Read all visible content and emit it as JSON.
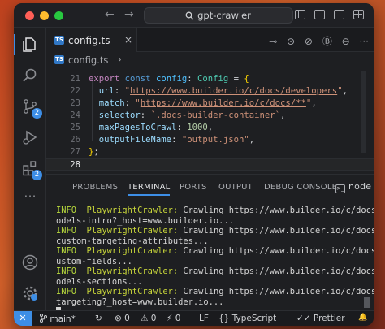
{
  "window": {
    "title": "gpt-crawler",
    "nav_back": "←",
    "nav_forward": "→"
  },
  "tab": {
    "label": "config.ts",
    "icon": "TS",
    "close": "×"
  },
  "editor_actions": [
    "⊸",
    "⊙",
    "⊘",
    "Ⓑ",
    "⊖",
    "···"
  ],
  "breadcrumb": {
    "file": "config.ts",
    "sep": "›"
  },
  "code": {
    "lines": [
      {
        "n": "21",
        "segments": [
          [
            "kw",
            "export "
          ],
          [
            "kw2",
            "const "
          ],
          [
            "var",
            "config"
          ],
          [
            "punc",
            ": "
          ],
          [
            "typ",
            "Config"
          ],
          [
            "punc",
            " = "
          ],
          [
            "brace",
            "{"
          ]
        ]
      },
      {
        "n": "22",
        "segments": [
          [
            "punc",
            "  "
          ],
          [
            "prop",
            "url"
          ],
          [
            "punc",
            ": "
          ],
          [
            "str",
            "\""
          ],
          [
            "str lnk",
            "https://www.builder.io/c/docs/developers"
          ],
          [
            "str",
            "\""
          ],
          [
            "punc",
            ","
          ]
        ]
      },
      {
        "n": "23",
        "segments": [
          [
            "punc",
            "  "
          ],
          [
            "prop",
            "match"
          ],
          [
            "punc",
            ": "
          ],
          [
            "str",
            "\""
          ],
          [
            "str lnk",
            "https://www.builder.io/c/docs/**"
          ],
          [
            "str",
            "\""
          ],
          [
            "punc",
            ","
          ]
        ]
      },
      {
        "n": "24",
        "segments": [
          [
            "punc",
            "  "
          ],
          [
            "prop",
            "selector"
          ],
          [
            "punc",
            ": "
          ],
          [
            "str",
            "`.docs-builder-container`"
          ],
          [
            "punc",
            ","
          ]
        ]
      },
      {
        "n": "25",
        "segments": [
          [
            "punc",
            "  "
          ],
          [
            "prop",
            "maxPagesToCrawl"
          ],
          [
            "punc",
            ": "
          ],
          [
            "num",
            "1000"
          ],
          [
            "punc",
            ","
          ]
        ]
      },
      {
        "n": "26",
        "segments": [
          [
            "punc",
            "  "
          ],
          [
            "prop",
            "outputFileName"
          ],
          [
            "punc",
            ": "
          ],
          [
            "str",
            "\"output.json\""
          ],
          [
            "punc",
            ","
          ]
        ]
      },
      {
        "n": "27",
        "segments": [
          [
            "brace",
            "}"
          ],
          [
            "punc",
            ";"
          ]
        ]
      },
      {
        "n": "28",
        "segments": []
      }
    ]
  },
  "panel": {
    "tabs": [
      "PROBLEMS",
      "TERMINAL",
      "PORTS",
      "OUTPUT",
      "DEBUG CONSOLE"
    ],
    "active_tab": "TERMINAL",
    "terminal_name": "node",
    "terminal_icon": ">_",
    "terminal_lines": [
      "odels-intro?_host=www.builder.io...",
      "custom-targeting-attributes...",
      "ustom-fields...",
      "odels-sections...",
      "targeting?_host=www.builder.io..."
    ],
    "terminal_info_lines": [
      {
        "level": "INFO",
        "source": "PlaywrightCrawler:",
        "msg": " Crawling https://www.builder.io/c/docs/m"
      },
      {
        "level": "INFO",
        "source": "PlaywrightCrawler:",
        "msg": " Crawling https://www.builder.io/c/docs/"
      },
      {
        "level": "INFO",
        "source": "PlaywrightCrawler:",
        "msg": " Crawling https://www.builder.io/c/docs/c"
      },
      {
        "level": "INFO",
        "source": "PlaywrightCrawler:",
        "msg": " Crawling https://www.builder.io/c/docs/m"
      },
      {
        "level": "INFO",
        "source": "PlaywrightCrawler:",
        "msg": " Crawling https://www.builder.io/c/docs/t"
      }
    ]
  },
  "status": {
    "remote": "✕",
    "branch": "main*",
    "sync": "↻",
    "errors": "⊗ 0",
    "warnings": "⚠ 0",
    "ports": "⚡ 0",
    "line_ending": "LF",
    "language": "{} TypeScript",
    "formatter": "✓✓ Prettier",
    "notifications": "🔔"
  },
  "activity_badge": "2",
  "colors": {
    "accent": "#3d8ee6",
    "ts_badge": "#3178c6",
    "terminal_info": "#b5d63c"
  }
}
